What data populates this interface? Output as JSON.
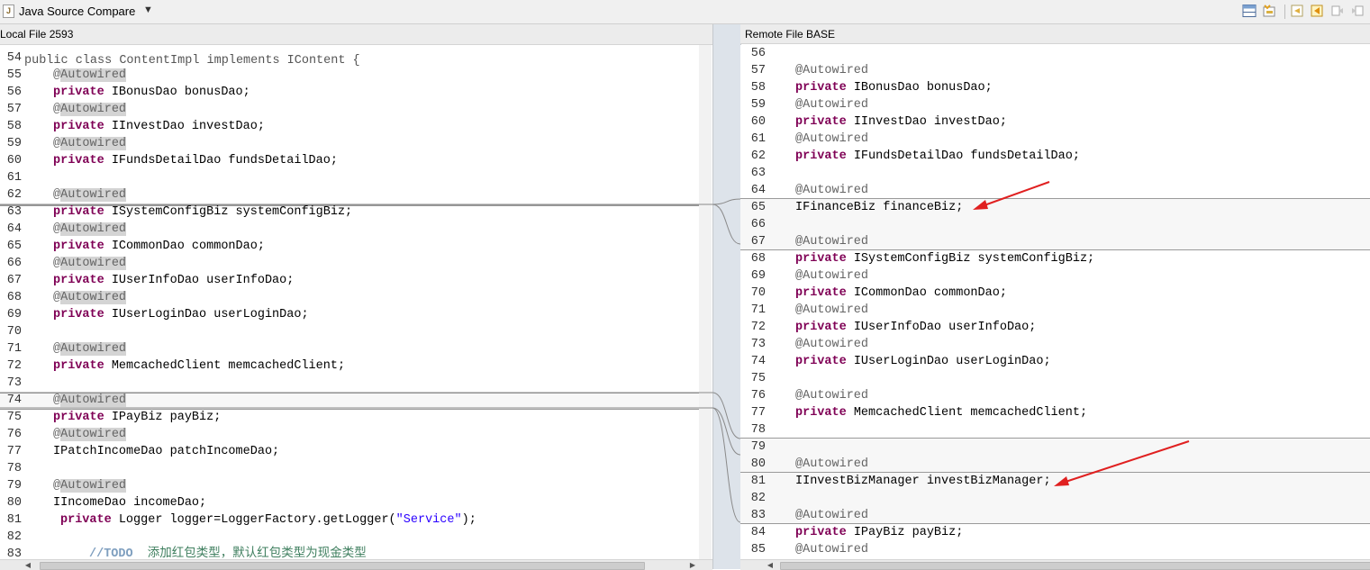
{
  "titlebar": {
    "title": "Java Source Compare",
    "icon_letter": "J",
    "dropdown_icon": "triangle-down-icon",
    "toolbar_icons": [
      "layout-horizontal-icon",
      "ignore-whitespace-icon",
      "copy-all-left-icon",
      "copy-current-left-icon",
      "next-diff-icon",
      "prev-diff-icon"
    ]
  },
  "left_pane": {
    "header": "Local File 2593",
    "first_line_text": "public class ContentImpl implements IContent {",
    "lines": [
      {
        "n": "54",
        "t": "blank"
      },
      {
        "n": "55",
        "t": "ann",
        "code": "@Autowired"
      },
      {
        "n": "56",
        "t": "field",
        "kw": "private ",
        "rest": "IBonusDao bonusDao;"
      },
      {
        "n": "57",
        "t": "ann",
        "code": "@Autowired"
      },
      {
        "n": "58",
        "t": "field",
        "kw": "private ",
        "rest": "IInvestDao investDao;"
      },
      {
        "n": "59",
        "t": "ann",
        "code": "@Autowired"
      },
      {
        "n": "60",
        "t": "field",
        "kw": "private ",
        "rest": "IFundsDetailDao fundsDetailDao;"
      },
      {
        "n": "61",
        "t": "blank"
      },
      {
        "n": "62",
        "t": "ann",
        "code": "@Autowired"
      },
      {
        "n": "63",
        "t": "field",
        "kw": "private ",
        "rest": "ISystemConfigBiz systemConfigBiz;"
      },
      {
        "n": "64",
        "t": "ann",
        "code": "@Autowired"
      },
      {
        "n": "65",
        "t": "field",
        "kw": "private ",
        "rest": "ICommonDao commonDao;"
      },
      {
        "n": "66",
        "t": "ann",
        "code": "@Autowired"
      },
      {
        "n": "67",
        "t": "field",
        "kw": "private ",
        "rest": "IUserInfoDao userInfoDao;"
      },
      {
        "n": "68",
        "t": "ann",
        "code": "@Autowired"
      },
      {
        "n": "69",
        "t": "field",
        "kw": "private ",
        "rest": "IUserLoginDao userLoginDao;"
      },
      {
        "n": "70",
        "t": "blank"
      },
      {
        "n": "71",
        "t": "ann",
        "code": "@Autowired"
      },
      {
        "n": "72",
        "t": "field",
        "kw": "private ",
        "rest": "MemcachedClient memcachedClient;"
      },
      {
        "n": "73",
        "t": "blank"
      },
      {
        "n": "74",
        "t": "ann",
        "code": "@Autowired"
      },
      {
        "n": "75",
        "t": "field",
        "kw": "private ",
        "rest": "IPayBiz payBiz;"
      },
      {
        "n": "76",
        "t": "ann",
        "code": "@Autowired"
      },
      {
        "n": "77",
        "t": "plain",
        "code": "IPatchIncomeDao patchIncomeDao;"
      },
      {
        "n": "78",
        "t": "blank"
      },
      {
        "n": "79",
        "t": "ann",
        "code": "@Autowired"
      },
      {
        "n": "80",
        "t": "plain",
        "code": "IIncomeDao incomeDao;"
      },
      {
        "n": "81",
        "t": "logger",
        "kw": "private ",
        "pre": "Logger logger=LoggerFactory.getLogger(",
        "str": "\"Service\"",
        "post": ");"
      },
      {
        "n": "82",
        "t": "blank"
      },
      {
        "n": "83",
        "t": "comment",
        "todo": "//TODO",
        "cmt": "  添加红包类型，默认红包类型为现金类型"
      }
    ]
  },
  "right_pane": {
    "header": "Remote File BASE",
    "lines": [
      {
        "n": "56",
        "t": "blank"
      },
      {
        "n": "57",
        "t": "ann",
        "code": "@Autowired"
      },
      {
        "n": "58",
        "t": "field",
        "kw": "private ",
        "rest": "IBonusDao bonusDao;"
      },
      {
        "n": "59",
        "t": "ann",
        "code": "@Autowired"
      },
      {
        "n": "60",
        "t": "field",
        "kw": "private ",
        "rest": "IInvestDao investDao;"
      },
      {
        "n": "61",
        "t": "ann",
        "code": "@Autowired"
      },
      {
        "n": "62",
        "t": "field",
        "kw": "private ",
        "rest": "IFundsDetailDao fundsDetailDao;"
      },
      {
        "n": "63",
        "t": "blank"
      },
      {
        "n": "64",
        "t": "ann",
        "code": "@Autowired"
      },
      {
        "n": "65",
        "t": "plain",
        "code": "IFinanceBiz financeBiz;"
      },
      {
        "n": "66",
        "t": "blank"
      },
      {
        "n": "67",
        "t": "ann",
        "code": "@Autowired"
      },
      {
        "n": "68",
        "t": "field",
        "kw": "private ",
        "rest": "ISystemConfigBiz systemConfigBiz;"
      },
      {
        "n": "69",
        "t": "ann",
        "code": "@Autowired"
      },
      {
        "n": "70",
        "t": "field",
        "kw": "private ",
        "rest": "ICommonDao commonDao;"
      },
      {
        "n": "71",
        "t": "ann",
        "code": "@Autowired"
      },
      {
        "n": "72",
        "t": "field",
        "kw": "private ",
        "rest": "IUserInfoDao userInfoDao;"
      },
      {
        "n": "73",
        "t": "ann",
        "code": "@Autowired"
      },
      {
        "n": "74",
        "t": "field",
        "kw": "private ",
        "rest": "IUserLoginDao userLoginDao;"
      },
      {
        "n": "75",
        "t": "blank"
      },
      {
        "n": "76",
        "t": "ann",
        "code": "@Autowired"
      },
      {
        "n": "77",
        "t": "field",
        "kw": "private ",
        "rest": "MemcachedClient memcachedClient;"
      },
      {
        "n": "78",
        "t": "blank"
      },
      {
        "n": "79",
        "t": "blank"
      },
      {
        "n": "80",
        "t": "ann",
        "code": "@Autowired"
      },
      {
        "n": "81",
        "t": "plain",
        "code": "IInvestBizManager investBizManager;"
      },
      {
        "n": "82",
        "t": "blank"
      },
      {
        "n": "83",
        "t": "ann",
        "code": "@Autowired"
      },
      {
        "n": "84",
        "t": "field",
        "kw": "private ",
        "rest": "IPayBiz payBiz;"
      },
      {
        "n": "85",
        "t": "ann",
        "code": "@Autowired"
      }
    ]
  },
  "colors": {
    "keyword": "#7f0055",
    "annotation": "#646464",
    "string": "#2a00ff",
    "comment": "#3f7f5f",
    "arrow": "#e02020"
  }
}
